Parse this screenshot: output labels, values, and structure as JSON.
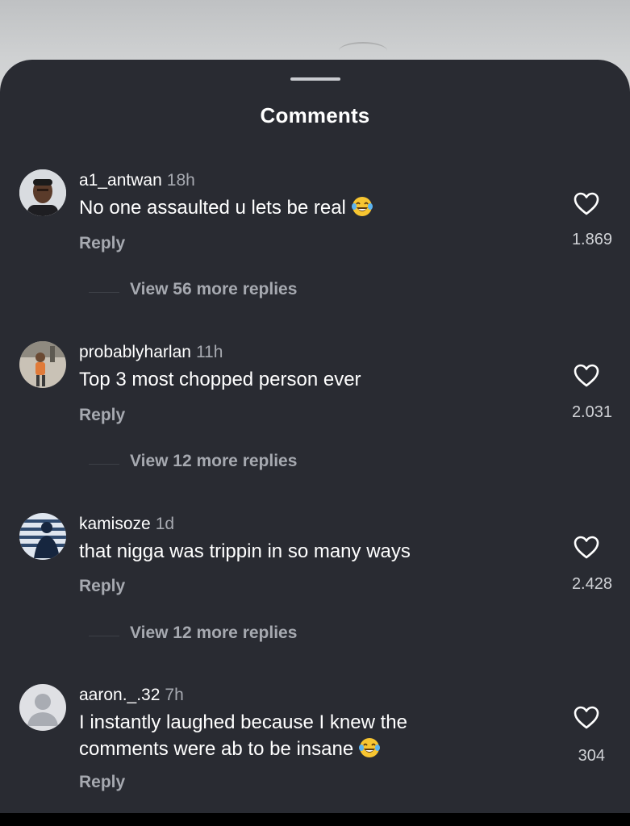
{
  "sheet": {
    "title": "Comments"
  },
  "comments": [
    {
      "username": "a1_antwan",
      "time": "18h",
      "text": "No one assaulted u lets be real",
      "emoji": "tears-of-joy",
      "reply_label": "Reply",
      "likes": "1.869",
      "view_more": "View 56 more replies",
      "avatar": "photo"
    },
    {
      "username": "probablyharlan",
      "time": "11h",
      "text": "Top 3 most chopped person ever",
      "reply_label": "Reply",
      "likes": "2.031",
      "view_more": "View 12 more replies",
      "avatar": "photo"
    },
    {
      "username": "kamisoze",
      "time": "1d",
      "text": "that nigga was trippin in so many ways",
      "reply_label": "Reply",
      "likes": "2.428",
      "view_more": "View 12 more replies",
      "avatar": "photo"
    },
    {
      "username": "aaron._.32",
      "time": "7h",
      "text": "I instantly laughed because I knew the comments were ab to be insane",
      "emoji": "tears-of-joy",
      "reply_label": "Reply",
      "likes": "304",
      "avatar": "default-silhouette"
    }
  ],
  "icons": {
    "like": "heart-outline-icon",
    "emoji": "face-with-tears-of-joy-icon"
  },
  "colors": {
    "sheet_bg": "#292b32",
    "muted_text": "#a6a9b0"
  }
}
